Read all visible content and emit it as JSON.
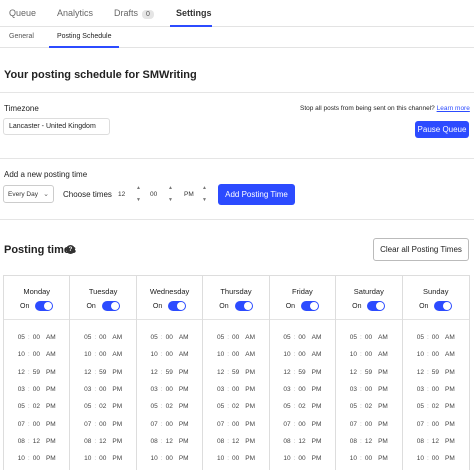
{
  "top_tabs": [
    {
      "label": "Queue"
    },
    {
      "label": "Analytics"
    },
    {
      "label": "Drafts",
      "badge": "0"
    },
    {
      "label": "Settings",
      "active": true
    }
  ],
  "sub_tabs": [
    {
      "label": "General"
    },
    {
      "label": "Posting Schedule",
      "active": true
    }
  ],
  "heading": "Your posting schedule for SMWriting",
  "timezone": {
    "label": "Timezone",
    "value": "Lancaster - United Kingdom"
  },
  "stop_posts": {
    "text": "Stop all posts from being sent on this channel?",
    "link": "Learn more",
    "button": "Pause Queue"
  },
  "add_time": {
    "label": "Add a new posting time",
    "frequency": "Every Day",
    "choose_label": "Choose times",
    "hour": "12",
    "minute": "00",
    "ampm": "PM",
    "button": "Add Posting Time"
  },
  "posting_times": {
    "title": "Posting times",
    "help": "?",
    "clear_button": "Clear all Posting Times"
  },
  "toggle_label": "On",
  "days": [
    "Monday",
    "Tuesday",
    "Wednesday",
    "Thursday",
    "Friday",
    "Saturday",
    "Sunday"
  ],
  "times": [
    {
      "h": "05",
      "m": "00",
      "p": "AM"
    },
    {
      "h": "10",
      "m": "00",
      "p": "AM"
    },
    {
      "h": "12",
      "m": "59",
      "p": "PM"
    },
    {
      "h": "03",
      "m": "00",
      "p": "PM"
    },
    {
      "h": "05",
      "m": "02",
      "p": "PM"
    },
    {
      "h": "07",
      "m": "00",
      "p": "PM"
    },
    {
      "h": "08",
      "m": "12",
      "p": "PM"
    },
    {
      "h": "10",
      "m": "00",
      "p": "PM"
    }
  ],
  "colors": {
    "accent": "#2c4bff"
  }
}
